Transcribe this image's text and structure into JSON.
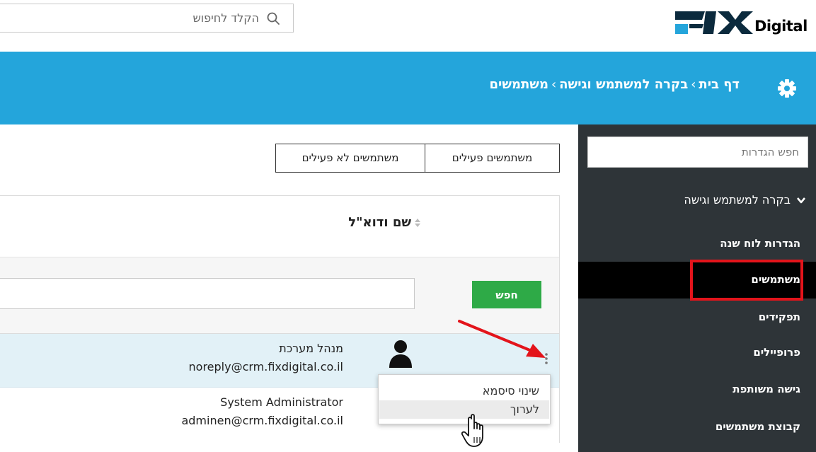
{
  "topbar": {
    "search_placeholder": "הקלד לחיפוש",
    "logo_text": "Digital"
  },
  "header": {
    "breadcrumb": [
      "דף בית",
      "בקרה למשתמש וגישה",
      "משתמשים"
    ],
    "breadcrumb_separator": "›",
    "background_color": "#24a5db"
  },
  "sidebar": {
    "search_placeholder": "חפש הגדרות",
    "section_label": "בקרה למשתמש וגישה",
    "items": [
      {
        "label": "הגדרות לוח שנה",
        "active": false
      },
      {
        "label": "משתמשים",
        "active": true
      },
      {
        "label": "תפקידים",
        "active": false
      },
      {
        "label": "פרופיילים",
        "active": false
      },
      {
        "label": "גישה משותפת",
        "active": false
      },
      {
        "label": "קבוצת משתמשים",
        "active": false
      }
    ],
    "background_color": "#2e3438",
    "highlight_color": "#e3141b"
  },
  "tabs": [
    {
      "label": "משתמשים פעילים",
      "active": true
    },
    {
      "label": "משתמשים לא פעילים",
      "active": false
    }
  ],
  "table": {
    "column_header": "שם ודוא\"ל",
    "filter_button_label": "חפש",
    "filter_button_color": "#2eaa47",
    "rows": [
      {
        "name": "מנהל מערכת",
        "email": "noreply@crm.fixdigital.co.il",
        "selected": true
      },
      {
        "name": "System Administrator",
        "email": "adminen@crm.fixdigital.co.il",
        "selected": false
      }
    ]
  },
  "row_menu": {
    "items": [
      "שינוי סיסמא",
      "לערוך"
    ],
    "hovered_index": 1
  }
}
